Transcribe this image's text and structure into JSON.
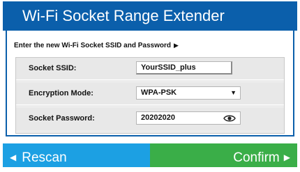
{
  "header": {
    "title": "Wi-Fi Socket Range Extender"
  },
  "instruction": {
    "text": "Enter the new Wi-Fi Socket SSID and Password",
    "arrow": "▶"
  },
  "form": {
    "ssid": {
      "label": "Socket SSID:",
      "value": "YourSSID_plus"
    },
    "encryption": {
      "label": "Encryption Mode:",
      "value": "WPA-PSK",
      "arrow": "▼"
    },
    "password": {
      "label": "Socket Password:",
      "value": "20202020",
      "icon": "eye-icon"
    }
  },
  "buttons": {
    "rescan": {
      "label": "Rescan",
      "arrow": "◀"
    },
    "confirm": {
      "label": "Confirm",
      "arrow": "▶"
    }
  },
  "colors": {
    "title_bar": "#0b5fab",
    "rescan": "#1ca0e3",
    "confirm": "#3aae48"
  }
}
